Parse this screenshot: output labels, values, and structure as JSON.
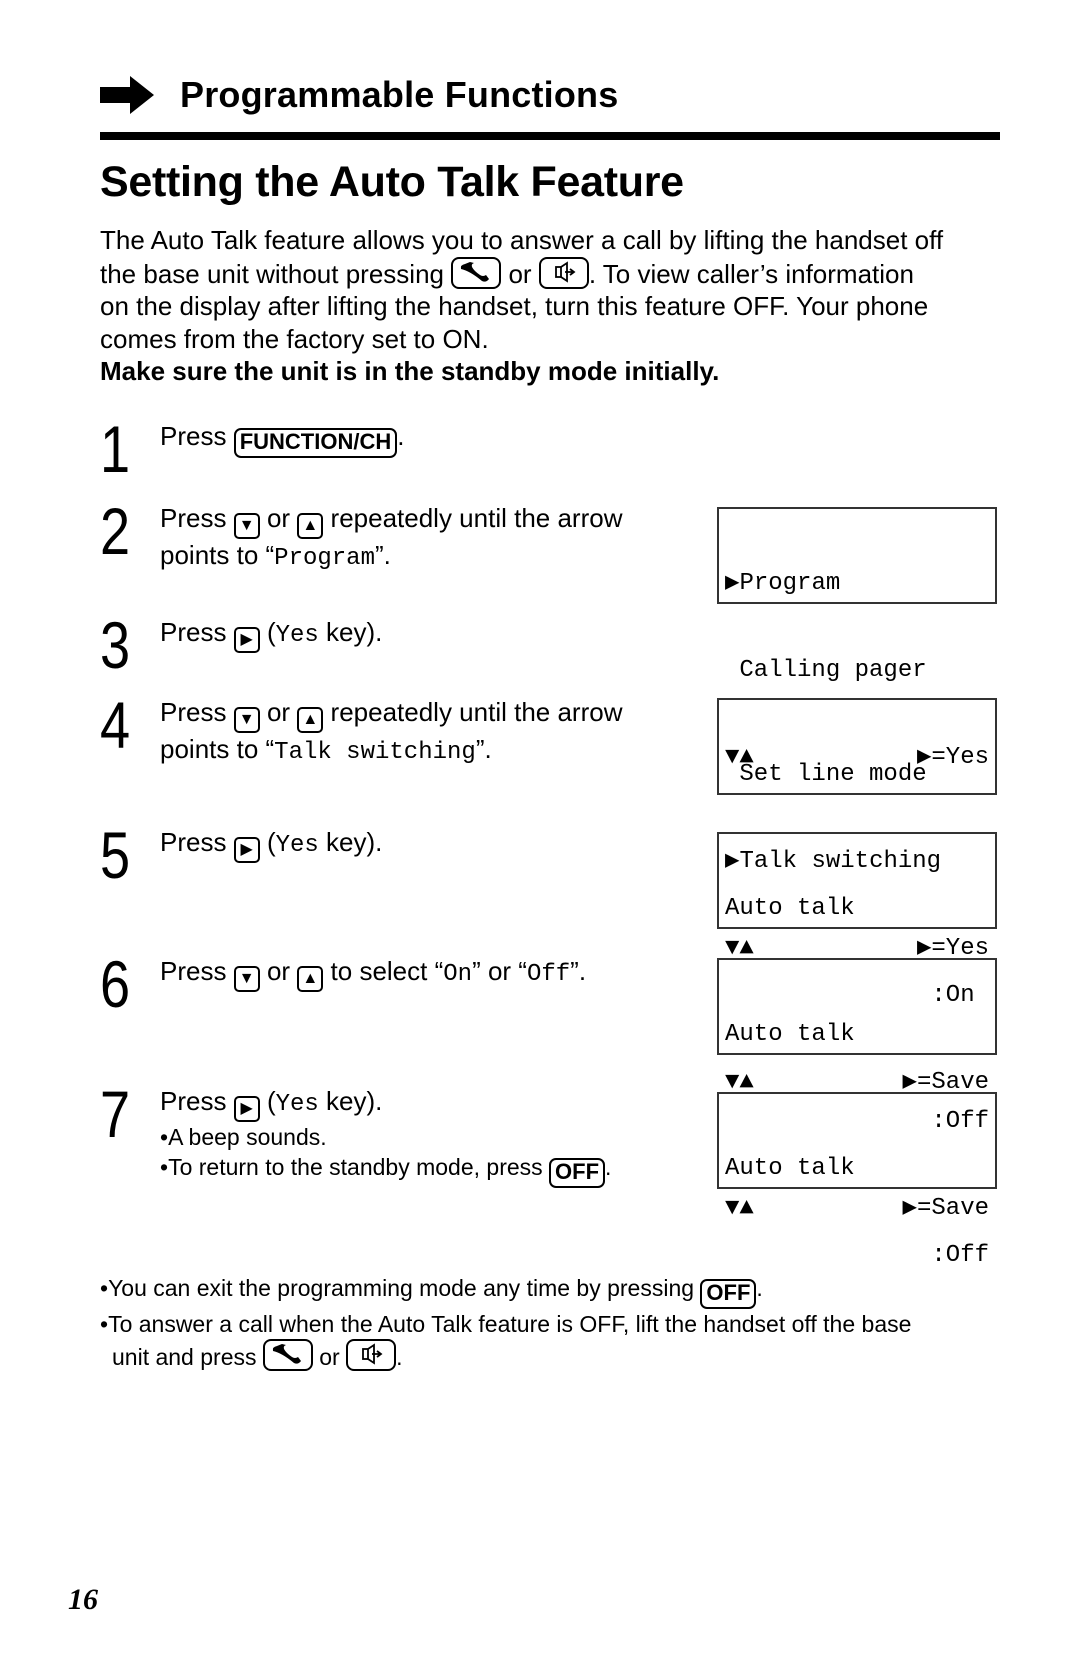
{
  "section_header": {
    "title": "Programmable Functions",
    "icon": "right-arrow-icon"
  },
  "heading": "Setting the Auto Talk Feature",
  "intro": {
    "line1": "The Auto Talk feature allows you to answer a call by lifting the handset off",
    "line2_a": "the base unit without pressing",
    "line2_or": "or",
    "line2_b": ". To view caller’s information",
    "line3": "on the display after lifting the handset, turn this feature OFF. Your phone",
    "line4": "comes from the factory set to ON.",
    "bold_note": "Make sure the unit is in the standby mode initially.",
    "keys": [
      "talk-key-icon",
      "speaker-key-icon"
    ]
  },
  "steps": [
    {
      "number": "1",
      "press": "Press",
      "key": "FUNCTION/CH",
      "end": "."
    },
    {
      "number": "2",
      "press": "Press",
      "down_key": "▼",
      "or": "or",
      "up_key": "▲",
      "rest": "repeatedly until the arrow",
      "line2_a": "points to “",
      "target": "Program",
      "line2_b": "”."
    },
    {
      "number": "3",
      "press": "Press",
      "key": "▶",
      "open": "(",
      "yes": "Yes",
      "rest": " key)."
    },
    {
      "number": "4",
      "press": "Press",
      "down_key": "▼",
      "or": "or",
      "up_key": "▲",
      "rest": "repeatedly until the arrow",
      "line2_a": "points to “",
      "target": "Talk switching",
      "line2_b": "”."
    },
    {
      "number": "5",
      "press": "Press",
      "key": "▶",
      "open": "(",
      "yes": "Yes",
      "rest": " key)."
    },
    {
      "number": "6",
      "press": "Press",
      "down_key": "▼",
      "or": "or",
      "up_key": "▲",
      "rest_a": "to select “",
      "opt_on": "On",
      "mid": "” or “",
      "opt_off": "Off",
      "rest_b": "”."
    },
    {
      "number": "7",
      "press": "Press",
      "key": "▶",
      "open": "(",
      "yes": "Yes",
      "rest": " key).",
      "bullets": [
        {
          "text": "A beep sounds."
        },
        {
          "text": "To return to the standby mode, press",
          "key": "OFF",
          "end": "."
        }
      ]
    }
  ],
  "displays": [
    {
      "rows": [
        {
          "left": "▶Program",
          "right": ""
        },
        {
          "left": " Calling pager",
          "right": ""
        },
        {
          "left": "▼▲",
          "right": "▶=Yes"
        }
      ]
    },
    {
      "rows": [
        {
          "left": " Set line mode",
          "right": ""
        },
        {
          "left": "▶Talk switching",
          "right": ""
        },
        {
          "left": "▼▲",
          "right": "▶=Yes"
        }
      ]
    },
    {
      "rows": [
        {
          "left": "Auto talk",
          "right": ""
        },
        {
          "left": "",
          "right": ":On "
        },
        {
          "left": "▼▲",
          "right": "▶=Save"
        }
      ]
    },
    {
      "rows": [
        {
          "left": "Auto talk",
          "right": ""
        },
        {
          "left": "",
          "right": ":Off"
        },
        {
          "left": "▼▲",
          "right": "▶=Save"
        }
      ]
    },
    {
      "rows": [
        {
          "left": "Auto talk",
          "right": ""
        },
        {
          "left": "",
          "right": ":Off"
        },
        {
          "left": "",
          "right": ""
        }
      ]
    }
  ],
  "notes": [
    {
      "text": "You can exit the programming mode any time by pressing",
      "key": "OFF",
      "end": "."
    },
    {
      "text": "To answer a call when the Auto Talk feature is OFF, lift the handset off the base",
      "line2": "unit and press",
      "or": "or",
      "end": "."
    }
  ],
  "page_number": "16"
}
